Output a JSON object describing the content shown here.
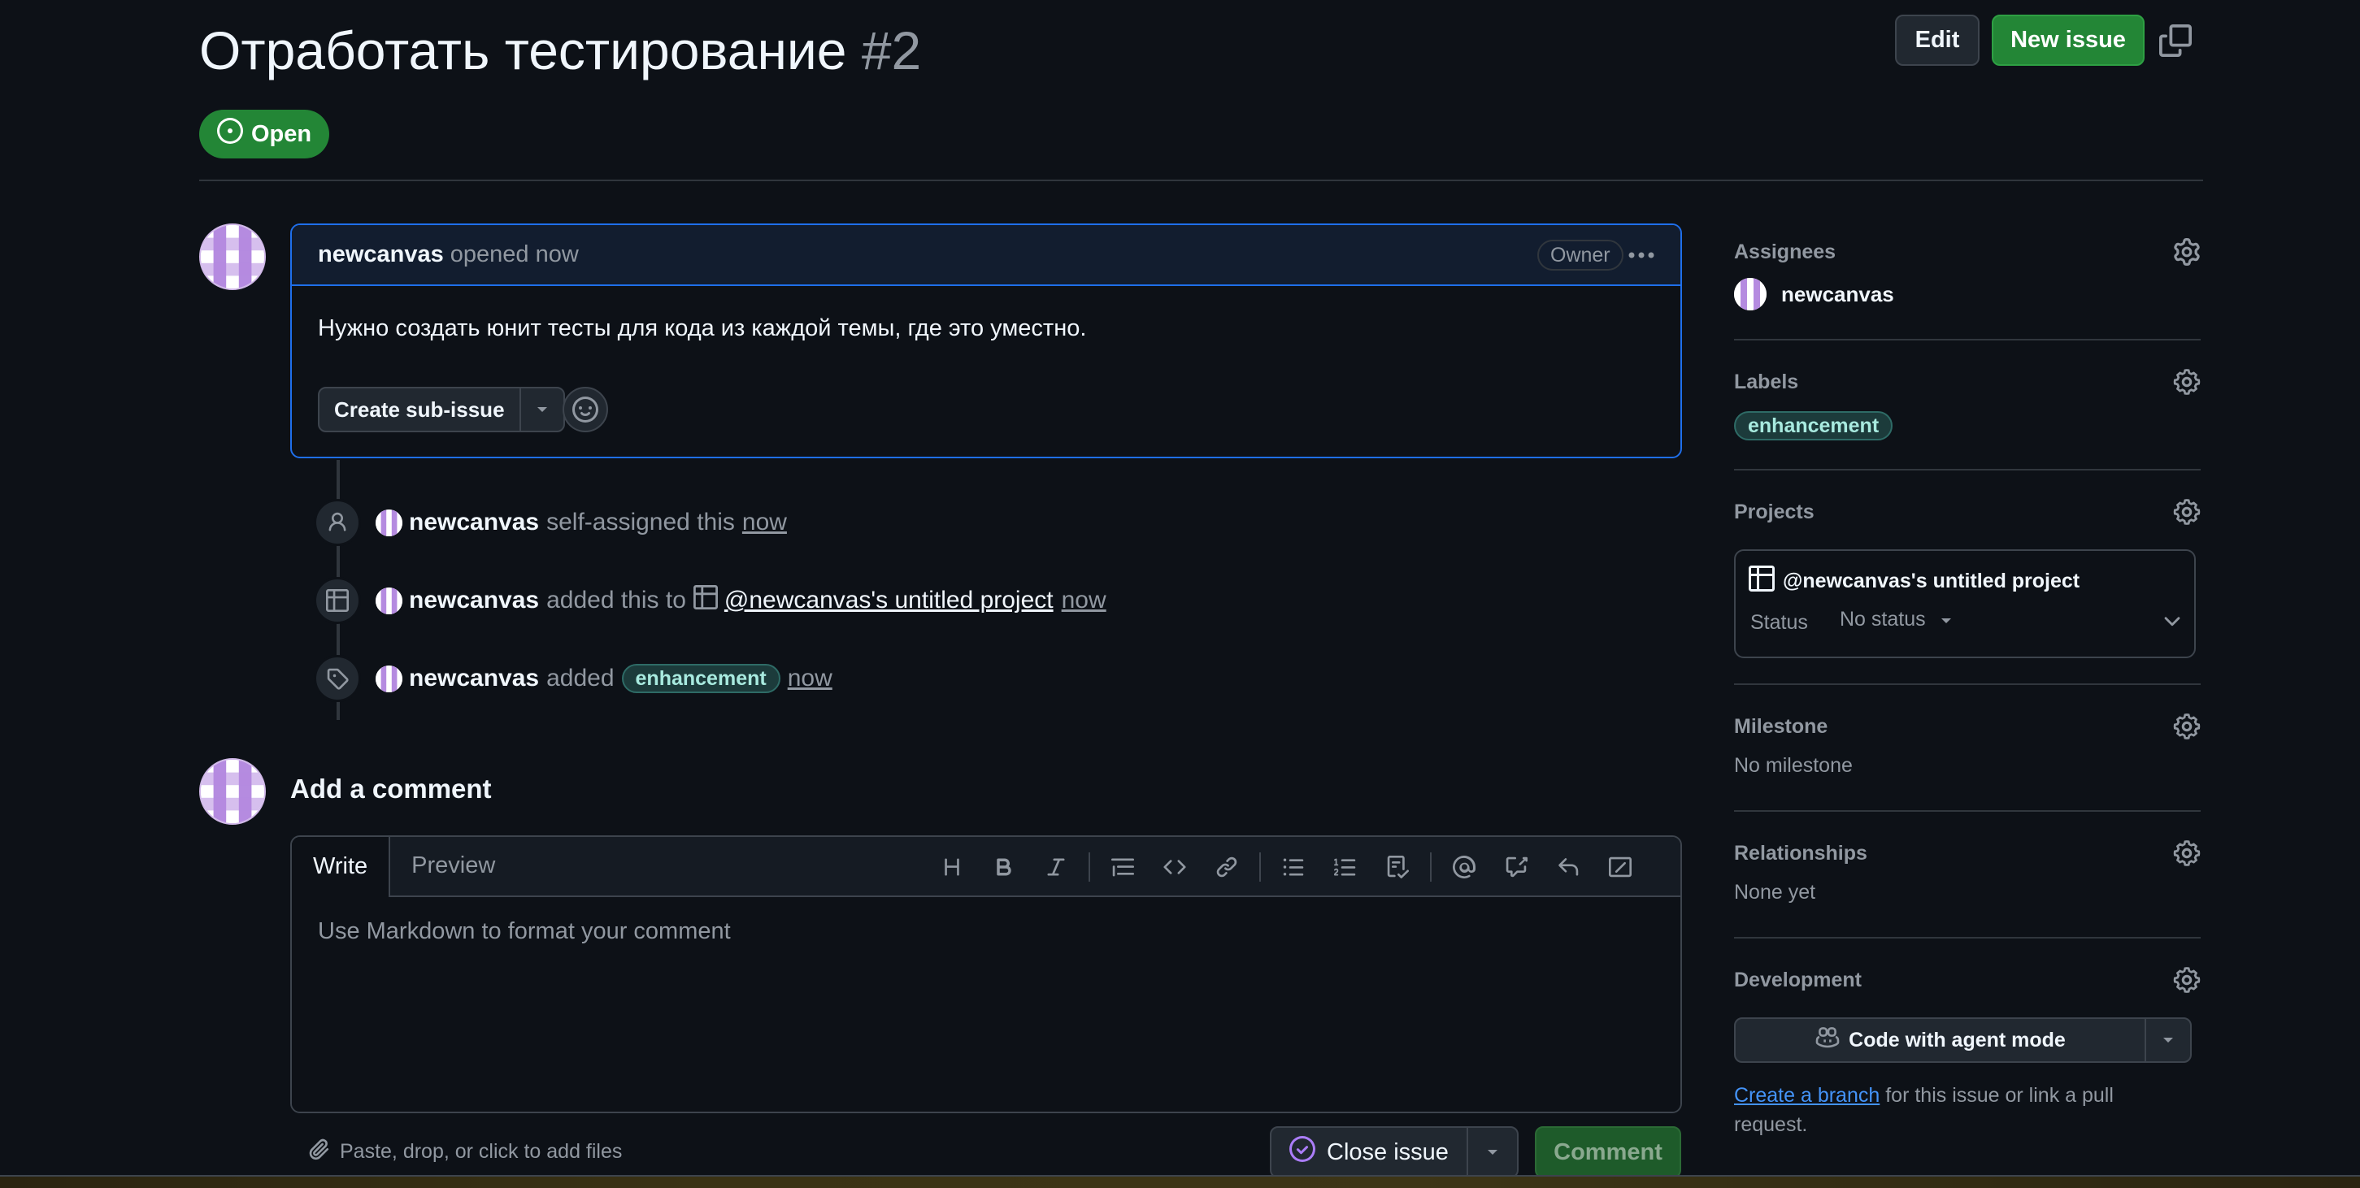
{
  "issue": {
    "title": "Отработать тестирование",
    "number": "#2",
    "state": "Open"
  },
  "header": {
    "edit_label": "Edit",
    "new_issue_label": "New issue"
  },
  "opening_comment": {
    "author": "newcanvas",
    "action": "opened now",
    "role_badge": "Owner",
    "body": "Нужно создать юнит тесты для кода из каждой темы, где это уместно.",
    "create_subissue_label": "Create sub-issue"
  },
  "timeline": [
    {
      "actor": "newcanvas",
      "action": "self-assigned this",
      "time": "now",
      "icon": "person-icon"
    },
    {
      "actor": "newcanvas",
      "action": "added this to",
      "project": "@newcanvas's untitled project",
      "time": "now",
      "icon": "table-icon"
    },
    {
      "actor": "newcanvas",
      "action": "added",
      "label": "enhancement",
      "time": "now",
      "icon": "tag-icon"
    }
  ],
  "add_comment": {
    "title": "Add a comment",
    "tabs": [
      "Write",
      "Preview"
    ],
    "placeholder": "Use Markdown to format your comment",
    "toolbar_icons": [
      "heading-icon",
      "bold-icon",
      "italic-icon",
      "quote-icon",
      "code-icon",
      "link-icon",
      "bulleted-list-icon",
      "numbered-list-icon",
      "task-list-icon",
      "mention-icon",
      "cross-reference-icon",
      "saved-reply-icon",
      "slash-command-icon"
    ],
    "attach_text": "Paste, drop, or click to add files",
    "close_issue_label": "Close issue",
    "comment_label": "Comment"
  },
  "sidebar": {
    "assignees": {
      "title": "Assignees",
      "value": "newcanvas"
    },
    "labels": {
      "title": "Labels",
      "value": "enhancement"
    },
    "projects": {
      "title": "Projects",
      "project_name": "@newcanvas's untitled project",
      "status_label": "Status",
      "status_value": "No status"
    },
    "milestone": {
      "title": "Milestone",
      "value": "No milestone"
    },
    "relationships": {
      "title": "Relationships",
      "value": "None yet"
    },
    "development": {
      "title": "Development",
      "agent_button": "Code with agent mode",
      "create_branch_link": "Create a branch",
      "note_rest": " for this issue or link a pull request."
    }
  },
  "colors": {
    "background": "#0d1117",
    "open_green": "#238636",
    "accent_blue": "#1f6feb",
    "link_blue": "#4493f8",
    "label_text": "#a8eadf",
    "avatar_purple": "#b58be0"
  }
}
